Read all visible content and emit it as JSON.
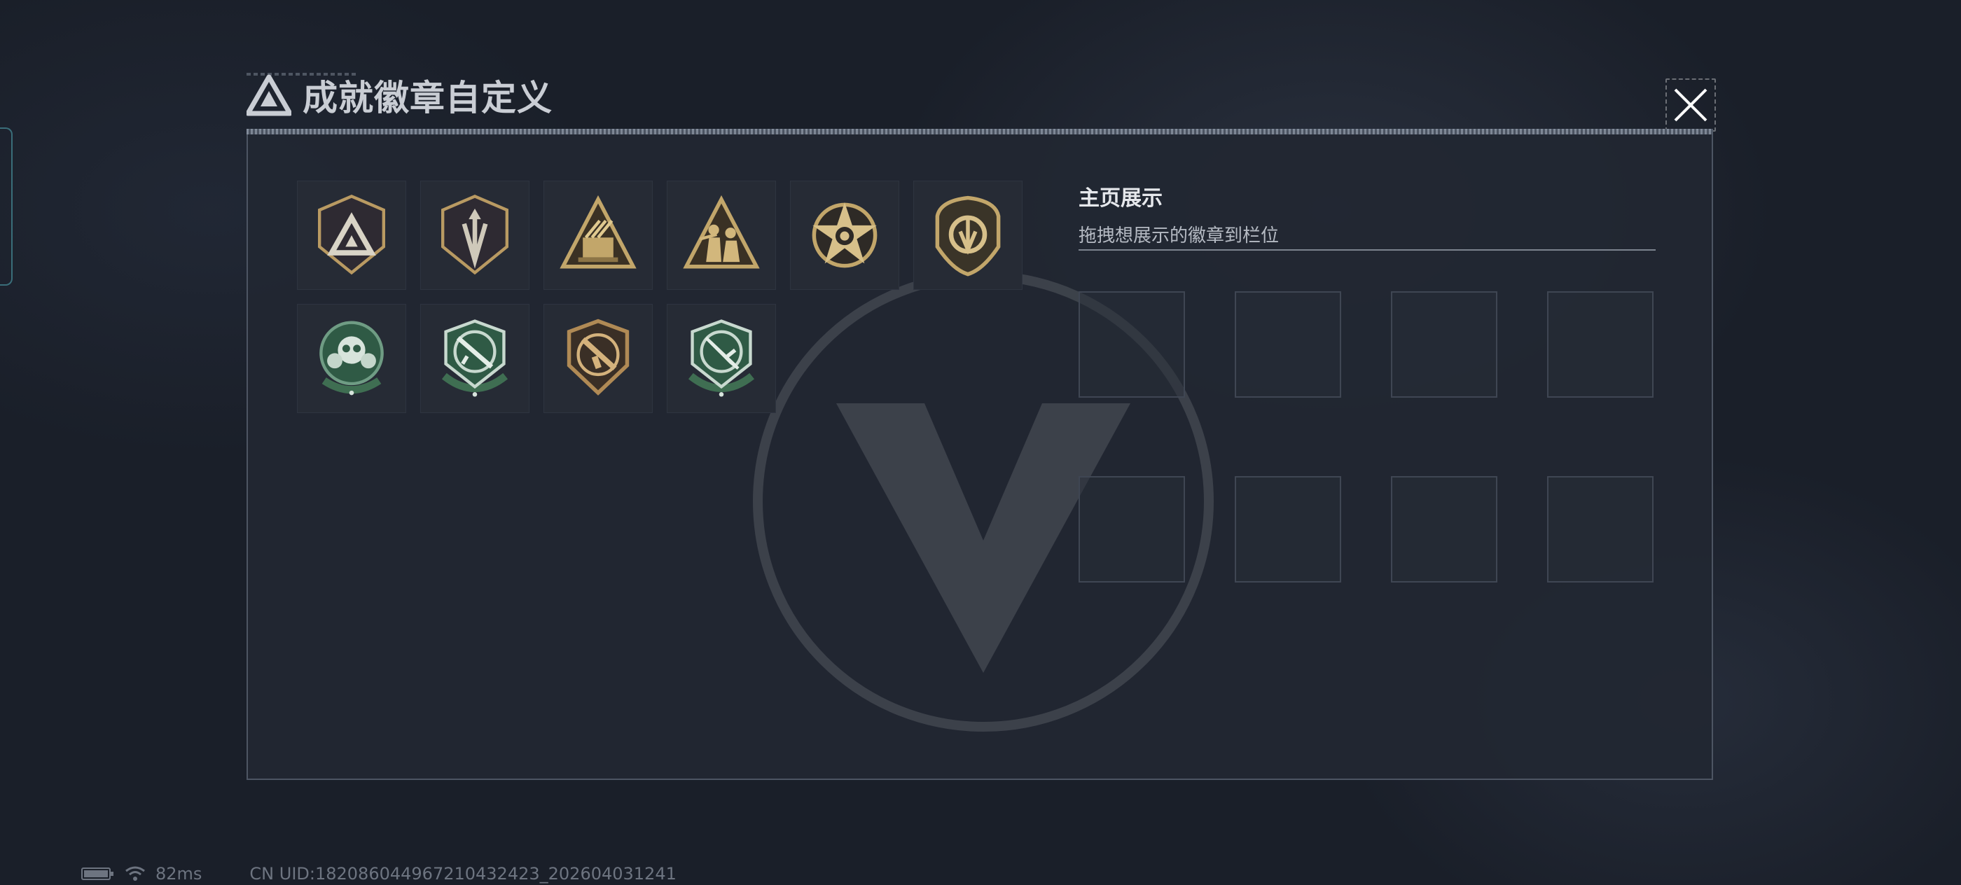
{
  "window": {
    "title": "成就徽章自定义",
    "close_icon": "close-icon",
    "logo_icon": "triangle-logo-icon"
  },
  "badges": [
    {
      "name": "triangle-shield-badge",
      "color": "#2e2a32"
    },
    {
      "name": "arrow-shield-badge",
      "color": "#2e2a32"
    },
    {
      "name": "rocket-triangle-badge",
      "color": "#c2a66a"
    },
    {
      "name": "soldiers-triangle-badge",
      "color": "#c2a66a"
    },
    {
      "name": "star-emblem-badge",
      "color": "#c2a66a"
    },
    {
      "name": "round-shield-badge",
      "color": "#c2a66a"
    },
    {
      "name": "green-skull-badge",
      "color": "#3f6e52"
    },
    {
      "name": "green-rifle-badge",
      "color": "#3f6e52"
    },
    {
      "name": "bronze-gun-badge",
      "color": "#b08a55"
    },
    {
      "name": "green-knife-badge",
      "color": "#3f6e52"
    }
  ],
  "display": {
    "title": "主页展示",
    "subtitle": "拖拽想展示的徽章到栏位",
    "slot_count": 8
  },
  "footer": {
    "ping": "82ms",
    "uid": "CN UID:182086044967210432423_202604031241"
  },
  "colors": {
    "accent_gold": "#c2a66a",
    "accent_green": "#3f6e52",
    "panel_bg": "#222732"
  }
}
